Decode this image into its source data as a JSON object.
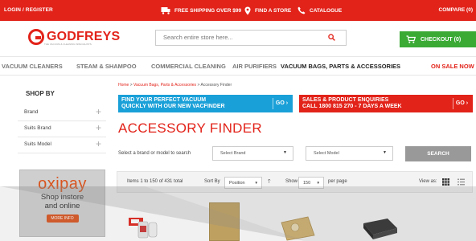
{
  "topbar": {
    "login": "LOGIN / REGISTER",
    "shipping": "FREE SHIPPING OVER $99",
    "store": "FIND A STORE",
    "catalogue": "CATALOGUE",
    "compare": "COMPARE (0)"
  },
  "header": {
    "logo": "GODFREYS",
    "logo_tagline": "THE VACUUM & CLEANING SPECIALISTS",
    "search_placeholder": "Search entire store here...",
    "checkout": "CHECKOUT (0)"
  },
  "nav": {
    "items": [
      "VACUUM CLEANERS",
      "STEAM & SHAMPOO",
      "COMMERCIAL CLEANING",
      "AIR PURIFIERS",
      "VACUUM BAGS, PARTS & ACCESSORIES",
      "ON SALE NOW"
    ]
  },
  "sidebar": {
    "shop_by": "SHOP BY",
    "facets": [
      "Brand",
      "Suits Brand",
      "Suits Model"
    ],
    "ad": {
      "brand": "oxipay",
      "line1": "Shop instore",
      "line2": "and online",
      "more": "MORE INFO"
    }
  },
  "main": {
    "breadcrumb": {
      "home": "Home",
      "category": "Vacuum Bags, Parts & Accessories",
      "current": "Accessory Finder",
      "sep": ">"
    },
    "banner_blue": {
      "line1": "FIND YOUR PERFECT VACUUM",
      "line2": "QUICKLY WITH OUR NEW VACFINDER",
      "go": "GO"
    },
    "banner_red": {
      "line1": "SALES & PRODUCT ENQUIRIES",
      "line2": "CALL 1800 815 270 - 7 DAYS A WEEK",
      "go": "GO"
    },
    "title": "ACCESSORY FINDER",
    "filter_label": "Select a brand or model to search",
    "select_brand": "Select Brand",
    "select_model": "Select Model",
    "search_button": "SEARCH",
    "toolbar": {
      "items": "Items 1 to 150 of 431 total",
      "sort_by": "Sort By",
      "sort_value": "Position",
      "show": "Show",
      "show_value": "150",
      "per_page": "per page",
      "view_as": "View as:"
    }
  },
  "colors": {
    "brand_red": "#e2231a",
    "checkout_green": "#3aaa35",
    "banner_blue": "#1aa0d8",
    "oxipay_orange": "#d9541e"
  }
}
